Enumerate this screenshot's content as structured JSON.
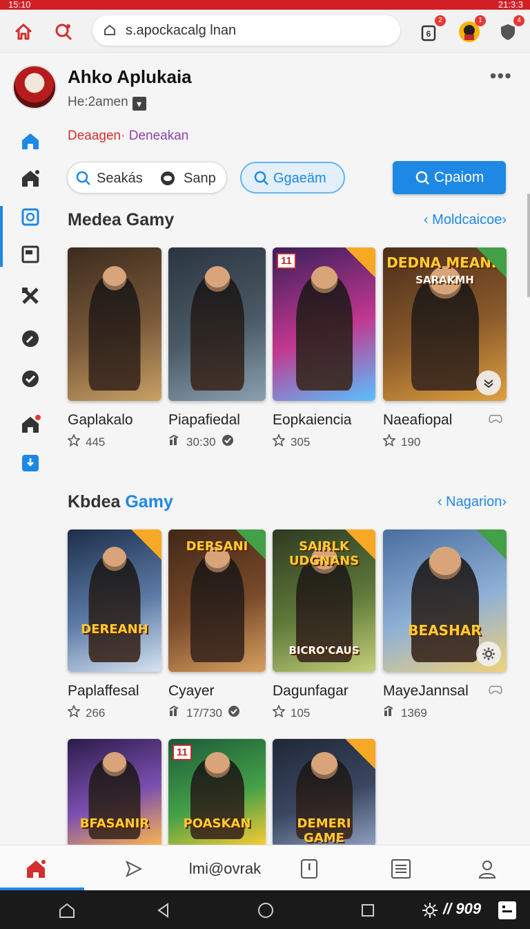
{
  "status": {
    "time": "15:10",
    "right": "21:3:3"
  },
  "browser": {
    "url": "s.apockacalg lnan",
    "badges": {
      "tabs": "2",
      "avatar": "1",
      "shield": "4"
    }
  },
  "profile": {
    "name": "Ahko Aplukaia",
    "subtitle": "He:2amen",
    "more": "•••"
  },
  "breadcrumb": {
    "first": "Deaagen·",
    "second": "Deneakan"
  },
  "filters": {
    "search_label": "Seakás",
    "snap_label": "Sanp",
    "secondary_label": "Ggaeäm",
    "primary_label": "Cpaiom"
  },
  "sections": [
    {
      "title": "Medea Gamy",
      "title_accent": "",
      "link": "Moldcaicoe",
      "games": [
        {
          "title": "Gaplakalo",
          "meta": "445",
          "meta_icon": "star-icon",
          "art": "",
          "colors": [
            "#3b2b1e",
            "#7a5a3a",
            "#c8a165"
          ]
        },
        {
          "title": "Piapafiedal",
          "meta": "30:30",
          "meta_icon": "trend-icon",
          "art": "",
          "colors": [
            "#2a3540",
            "#4b5a66",
            "#8aa1b0"
          ]
        },
        {
          "title": "Eopkaiencia",
          "meta": "305",
          "meta_icon": "star-icon",
          "art": "",
          "colors": [
            "#3a1f5c",
            "#c2378f",
            "#58c1ff"
          ],
          "corner": "11"
        },
        {
          "title": "Naeafiopal",
          "meta": "190",
          "meta_icon": "star-icon",
          "art": "DEDNA MEANH",
          "art_sub": "SARAKMH",
          "colors": [
            "#4a2d1a",
            "#8a5a2a",
            "#e0a040"
          ]
        }
      ]
    },
    {
      "title": "Kbdea",
      "title_accent": "Gamy",
      "link": "Nagarion",
      "games": [
        {
          "title": "Paplaffesal",
          "meta": "266",
          "meta_icon": "star-icon",
          "art": "DEREANH",
          "colors": [
            "#1d2e4a",
            "#5b7aa6",
            "#d7e3f2"
          ]
        },
        {
          "title": "Cyayer",
          "meta": "17/730",
          "meta_icon": "trend-icon",
          "art": "DERSANI",
          "colors": [
            "#402818",
            "#7a4a2a",
            "#d7a060"
          ]
        },
        {
          "title": "Dagunfagar",
          "meta": "105",
          "meta_icon": "star-icon",
          "art": "SAIRLK UDGNANS",
          "art_sub": "BICRO'CAUS",
          "colors": [
            "#2e3a22",
            "#5f7a3a",
            "#c5d07a"
          ]
        },
        {
          "title": "MayeJannsal",
          "meta": "1369",
          "meta_icon": "trend-icon",
          "art": "BEASHAR",
          "colors": [
            "#4a6ea0",
            "#8fb0d6",
            "#f0d27a"
          ]
        }
      ]
    },
    {
      "title": "",
      "games": [
        {
          "art": "BFASANIR",
          "colors": [
            "#2b1c4a",
            "#7b4fb0",
            "#ffb74d"
          ]
        },
        {
          "art": "POASKAN",
          "colors": [
            "#1c5a3a",
            "#43a047",
            "#ffcc33"
          ],
          "corner": "11"
        },
        {
          "art": "DEMERI GAME",
          "colors": [
            "#202838",
            "#3a4660",
            "#8fa0c0"
          ]
        }
      ]
    }
  ],
  "bottom_nav": {
    "center_label": "lmi@ovrak"
  },
  "system_nav": {
    "right_text": "909"
  },
  "accent": "#1e88e5",
  "brand_red": "#d32f2f"
}
